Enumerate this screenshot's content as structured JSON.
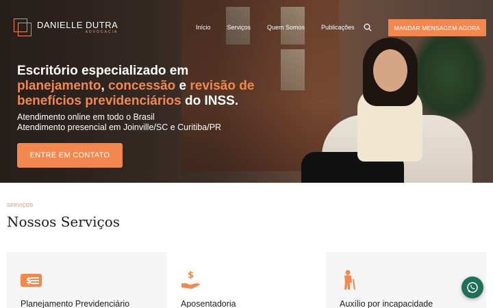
{
  "brand": {
    "name": "DANIELLE DUTRA",
    "sub": "ADVOCACIA",
    "accent": "#f2884f"
  },
  "nav": {
    "items": [
      "Início",
      "Serviços",
      "Quem Somos",
      "Publicações"
    ],
    "search_icon": "search-icon",
    "cta": "MANDAR MENSAGEM AGORA"
  },
  "hero": {
    "line1": "Escritório especializado em",
    "hl1": "planejamento",
    "sep1": ", ",
    "hl2": "concessão",
    "sep2": " e ",
    "hl3": "revisão de benefícios previdenciários",
    "tail": " do INSS.",
    "sub1": "Atendimento online em todo o Brasil",
    "sub2": "Atendimento presencial em Joinville/SC e Curitiba/PR",
    "cta": "ENTRE EM CONTATO"
  },
  "services": {
    "eyebrow": "SERVIÇOS",
    "title": "Nossos Serviços",
    "cards": [
      {
        "label": "Planejamento Previdenciário",
        "icon": "money-list-icon"
      },
      {
        "label": "Aposentadoria",
        "icon": "hand-money-icon"
      },
      {
        "label": "Auxílio por incapacidade",
        "icon": "person-cane-icon"
      }
    ]
  },
  "floating": {
    "whatsapp_icon": "whatsapp-icon",
    "whatsapp_color": "#1f6f5b"
  }
}
